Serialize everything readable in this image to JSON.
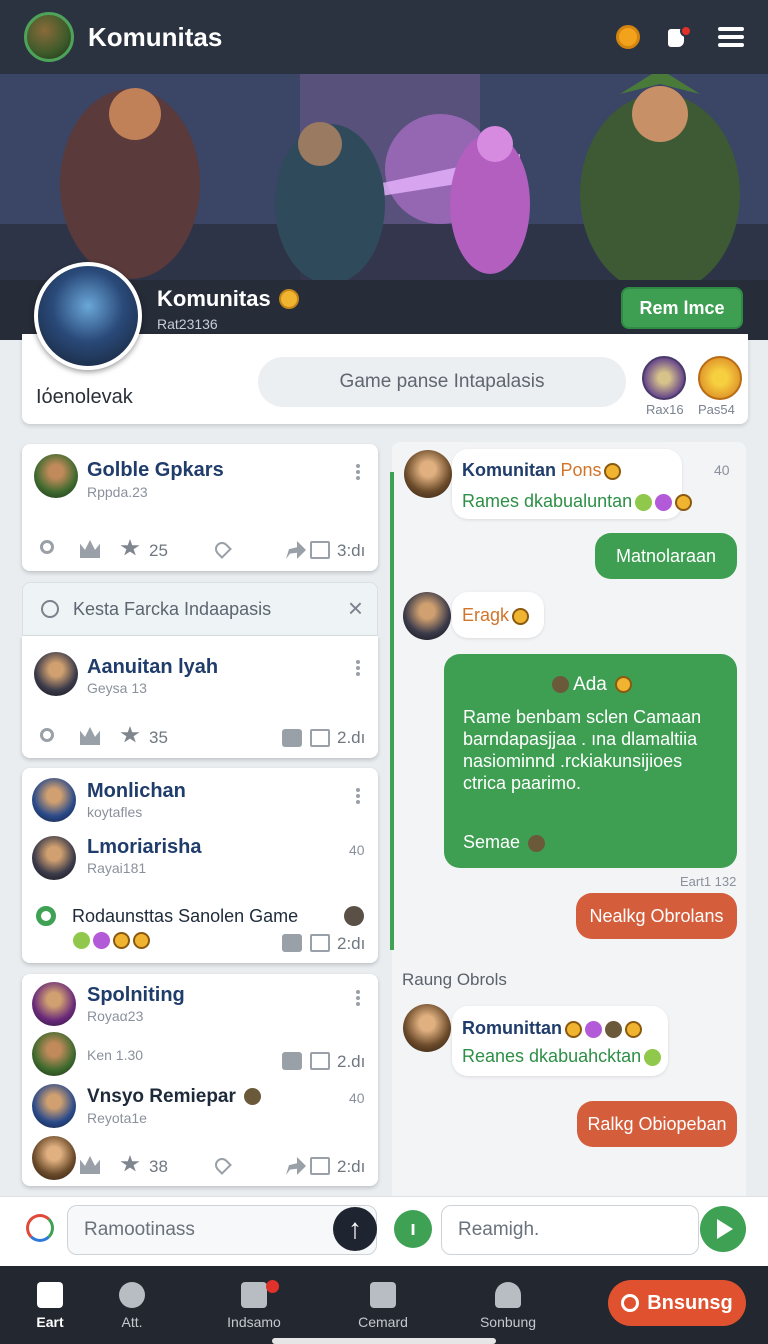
{
  "app": {
    "title": "Komunitas",
    "header_icons": [
      "search-icon",
      "notification-icon",
      "menu-icon"
    ]
  },
  "profile": {
    "name": "Komunitas",
    "handle": "Rat23136",
    "subtitle": "Iόenolevak",
    "join_label": "Rem lmce",
    "search_placeholder": "Game panse Intapalasis",
    "badge_a_label": "Rax16",
    "badge_b_label": "Pas54"
  },
  "posts": [
    {
      "title": "Golble Gpkars",
      "sub": "Rppda.23",
      "likes": "25",
      "shares": "3:dı"
    },
    {
      "title": "Aanuitan lyah",
      "sub": "Geysa 13",
      "likes": "35",
      "shares": "2.dı"
    },
    {
      "items": [
        {
          "title": "Monlichan",
          "sub": "koytafles"
        },
        {
          "title": "Lmoriarisha",
          "sub": "Rayai181",
          "count": "40"
        }
      ],
      "footer_title": "Rodaunsttas Sanolen Game",
      "shares": "2:dı"
    },
    {
      "items": [
        {
          "title": "Spolniting",
          "sub": "Royaα23"
        },
        {
          "sub": "Ken 1.30",
          "shares": "2.dı"
        },
        {
          "title": "Vnsyo Remiepar",
          "sub": "Reyota1e",
          "count": "40"
        }
      ],
      "likes": "38",
      "shares": "2:dı"
    }
  ],
  "filter": {
    "placeholder": "Kesta Farcka Indaapasis"
  },
  "chat": {
    "messages": [
      {
        "name": "Komunitan",
        "tag": "Pons",
        "text": "Rames dkabualuntan",
        "time": "40"
      },
      {
        "out_text": "Matnolaraan"
      },
      {
        "name": "Eragk"
      },
      {
        "title": "Ada",
        "body": "Rame benbam sclen Camaan barndapasjjaa . ına dlamaltiia nasiominnd .rckiakunsijioes ctrica paarimo.",
        "footer": "Semae"
      },
      {
        "time": "Eart1 132",
        "out_text": "Nealkg Obrolans"
      },
      {
        "section": "Raung Obrols"
      },
      {
        "name": "Romunittan",
        "text": "Reanes dkabuahcktan"
      },
      {
        "out_text": "Ralkg Obiopeban"
      }
    ]
  },
  "composer": {
    "left_placeholder": "Ramootinass",
    "right_placeholder": "Reamigh."
  },
  "nav": [
    {
      "label": "Eart",
      "active": true
    },
    {
      "label": "Att."
    },
    {
      "label": "Indsamo"
    },
    {
      "label": "Cemard"
    },
    {
      "label": "Sonbung"
    }
  ],
  "nav_cta_label": "Bnsunsg",
  "colors": {
    "accent_green": "#3e9f53",
    "accent_orange": "#d45d3b",
    "topbar_bg": "#2b3340",
    "nav_bg": "#23272f"
  }
}
